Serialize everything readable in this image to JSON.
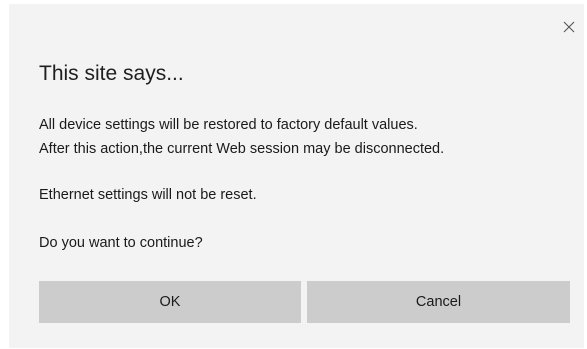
{
  "dialog": {
    "title": "This site says...",
    "close_icon": "close-icon",
    "message_line1": "All device settings will be restored to factory default values.",
    "message_line2": "After this action,the current Web session may be disconnected.",
    "message_line3": "Ethernet settings will not be reset.",
    "question": "Do you want to continue?",
    "ok_label": "OK",
    "cancel_label": "Cancel"
  },
  "colors": {
    "dialog_background": "#f3f3f3",
    "button_background": "#cccccc",
    "text": "#1a1a1a"
  }
}
